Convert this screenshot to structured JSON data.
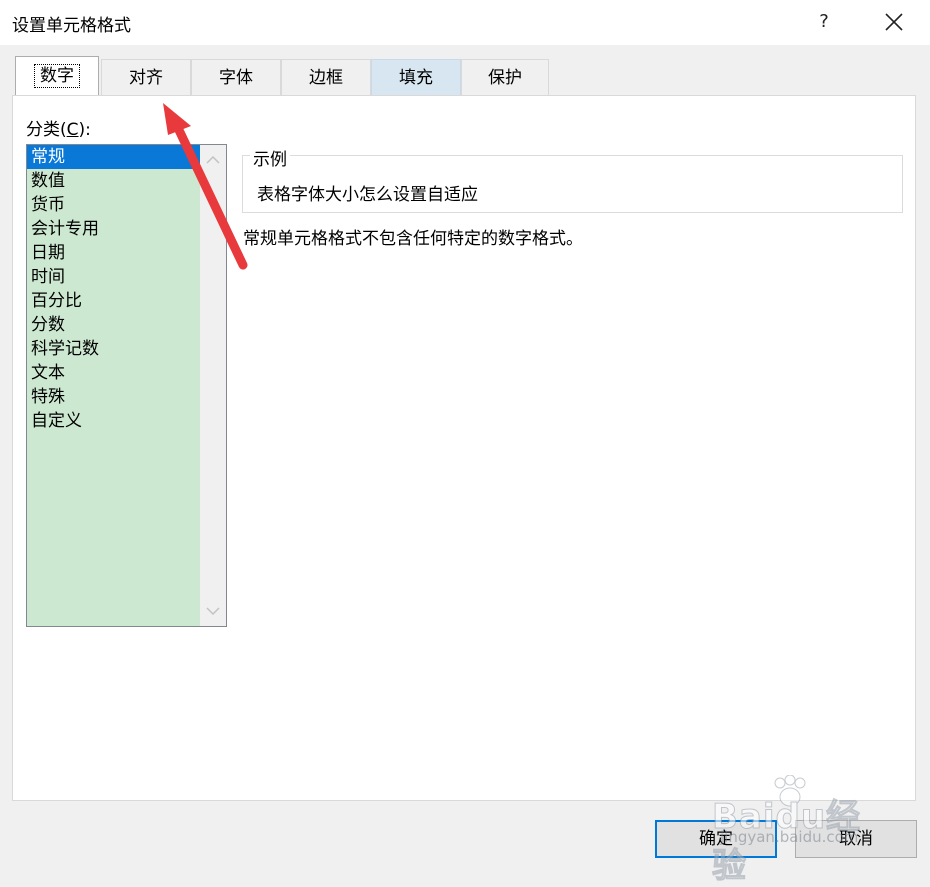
{
  "window": {
    "title": "设置单元格格式",
    "help_label": "?",
    "close_icon": "close-icon"
  },
  "tabs": [
    {
      "label": "数字",
      "active": true
    },
    {
      "label": "对齐",
      "active": false
    },
    {
      "label": "字体",
      "active": false
    },
    {
      "label": "边框",
      "active": false
    },
    {
      "label": "填充",
      "active": false,
      "hover": true
    },
    {
      "label": "保护",
      "active": false
    }
  ],
  "category": {
    "label_prefix": "分类(",
    "label_accel": "C",
    "label_suffix": "):",
    "items": [
      "常规",
      "数值",
      "货币",
      "会计专用",
      "日期",
      "时间",
      "百分比",
      "分数",
      "科学记数",
      "文本",
      "特殊",
      "自定义"
    ],
    "selected": "常规"
  },
  "sample": {
    "legend": "示例",
    "text": "表格字体大小怎么设置自适应"
  },
  "description": "常规单元格格式不包含任何特定的数字格式。",
  "buttons": {
    "ok": "确定",
    "cancel": "取消"
  },
  "watermark": {
    "brand": "Baidu经验",
    "url": "jingyan.baidu.com"
  },
  "colors": {
    "selection": "#0a78d7",
    "list_bg": "#cce8d1",
    "arrow": "#e8393c",
    "ok_border": "#0078d7"
  }
}
